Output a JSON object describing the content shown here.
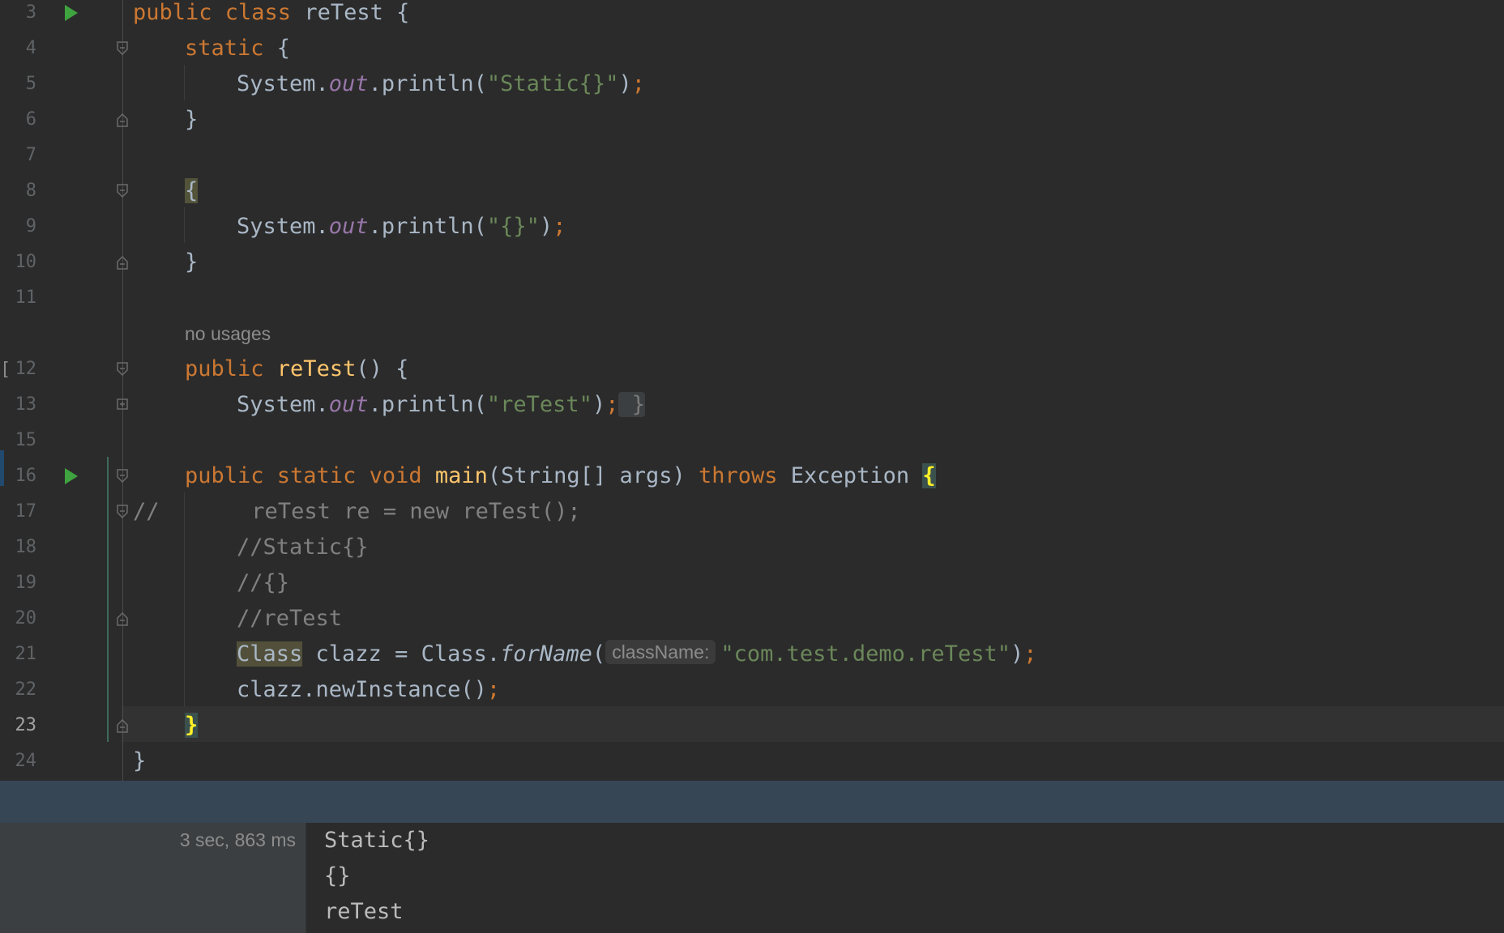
{
  "editor": {
    "lines": [
      {
        "n": "3"
      },
      {
        "n": "4"
      },
      {
        "n": "5"
      },
      {
        "n": "6"
      },
      {
        "n": "7"
      },
      {
        "n": "8"
      },
      {
        "n": "9"
      },
      {
        "n": "10"
      },
      {
        "n": "11"
      },
      {
        "n": "12"
      },
      {
        "n": "13"
      },
      {
        "n": "15"
      },
      {
        "n": "16"
      },
      {
        "n": "17"
      },
      {
        "n": "18"
      },
      {
        "n": "19"
      },
      {
        "n": "20"
      },
      {
        "n": "21"
      },
      {
        "n": "22"
      },
      {
        "n": "23"
      },
      {
        "n": "24"
      }
    ],
    "code": {
      "l3": {
        "kw1": "public class ",
        "name": "reTest",
        "rest": " {"
      },
      "l4": {
        "kw": "static",
        "rest": " {"
      },
      "l5": {
        "a": "System.",
        "fld": "out",
        "b": ".println(",
        "str": "\"Static{}\"",
        "c": ")",
        "semi": ";"
      },
      "l6": {
        "text": "}"
      },
      "l8": {
        "text": "{"
      },
      "l9": {
        "a": "System.",
        "fld": "out",
        "b": ".println(",
        "str": "\"{}\"",
        "c": ")",
        "semi": ";"
      },
      "l10": {
        "text": "}"
      },
      "l12": {
        "kw": "public ",
        "fn": "reTest",
        "rest": "() {"
      },
      "l13": {
        "a": "System.",
        "fld": "out",
        "b": ".println(",
        "str": "\"reTest\"",
        "c": ")",
        "semi": ";",
        "fold": " }"
      },
      "l16": {
        "kw1": "public static void ",
        "fn": "main",
        "a": "(String[] args) ",
        "kw2": "throws",
        "b": " Exception ",
        "brace": "{"
      },
      "l17": {
        "cmt1": "//",
        "cmt2": "       reTest re = new reTest();"
      },
      "l18": {
        "cmt": "//Static{}"
      },
      "l19": {
        "cmt": "//{}"
      },
      "l20": {
        "cmt": "//reTest"
      },
      "l21": {
        "cls": "Class",
        "a": " clazz = Class.",
        "ital": "forName",
        "b": "(",
        "hint": "className:",
        "str": "\"com.test.demo.reTest\"",
        "c": ")",
        "semi": ";"
      },
      "l22": {
        "a": "clazz.newInstance()",
        "semi": ";"
      },
      "l23": {
        "brace": "}"
      },
      "l24": {
        "text": "}"
      }
    },
    "usages_hint": "no usages",
    "current_line": "23"
  },
  "run_panel": {
    "duration": "3 sec, 863 ms",
    "output": [
      "Static{}",
      "{}",
      "reTest"
    ]
  },
  "colors": {
    "background": "#2b2b2b",
    "keyword": "#cc7832",
    "function": "#ffc66d",
    "string": "#6a8759",
    "field": "#9876aa",
    "comment": "#808080",
    "run_icon": "#3fa43f",
    "panel_header": "#364655"
  },
  "icons": [
    "run-icon",
    "fold-icon"
  ]
}
